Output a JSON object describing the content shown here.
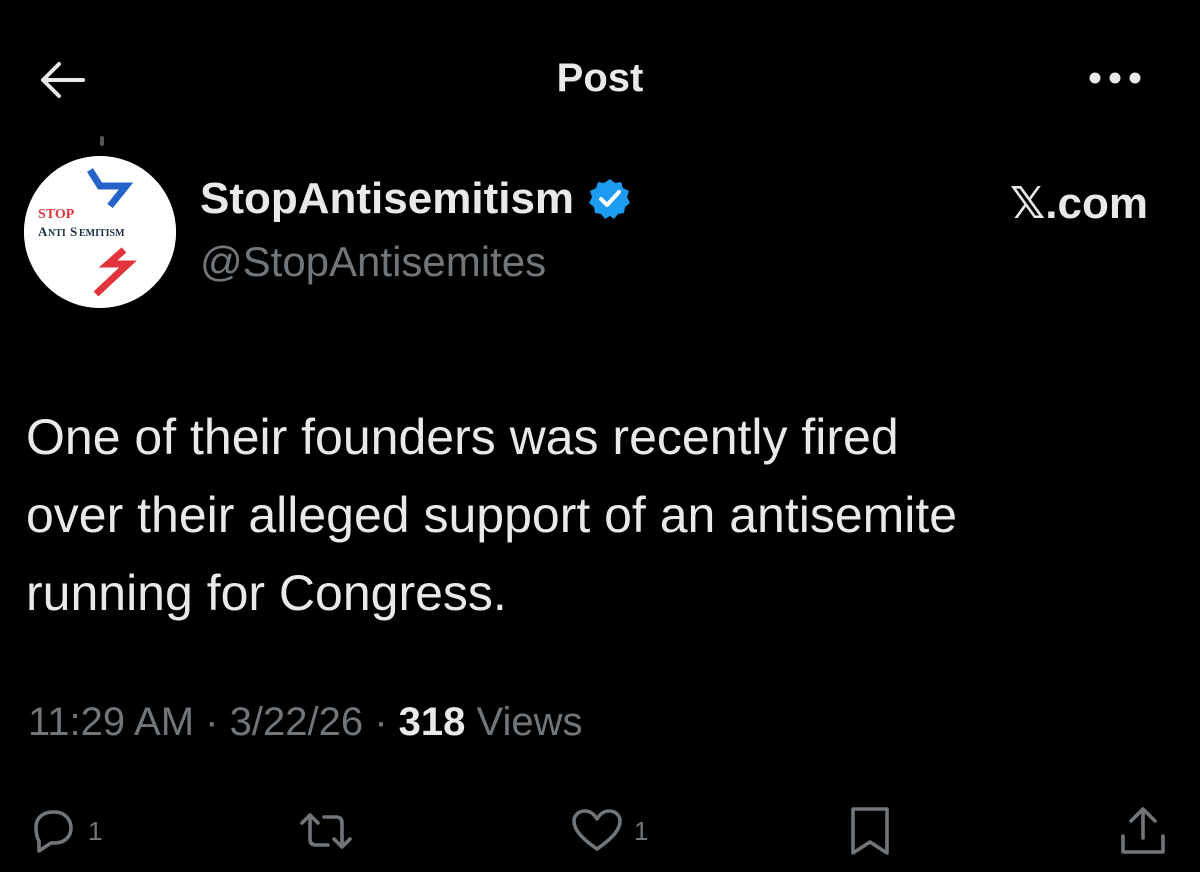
{
  "header": {
    "title": "Post",
    "back_icon": "arrow-left-icon",
    "more_icon": "more-horizontal-icon"
  },
  "author": {
    "display_name": "StopAntisemitism",
    "handle": "@StopAntisemites",
    "verified": true,
    "verified_color": "#1d9bf0",
    "avatar_logo_text": [
      "STOP",
      "ANTISEMITISM"
    ],
    "avatar_colors": {
      "blue": "#2563c9",
      "red": "#e3343c",
      "background": "#ffffff"
    }
  },
  "source": "𝕏.com",
  "tweet": {
    "lines": [
      "One of their founders was recently fired",
      "over their alleged support of an antisemite",
      "running for Congress."
    ]
  },
  "meta": {
    "time": "11:29 AM",
    "date": "3/22/26",
    "separator": "·",
    "views_count": "318",
    "views_label": "Views"
  },
  "actions": {
    "reply": {
      "icon": "reply-icon",
      "count": "1"
    },
    "repost": {
      "icon": "repost-icon",
      "count": ""
    },
    "like": {
      "icon": "heart-icon",
      "count": "1"
    },
    "bookmark": {
      "icon": "bookmark-icon"
    },
    "share": {
      "icon": "share-icon"
    }
  },
  "colors": {
    "background": "#000000",
    "text_primary": "#e7e9ea",
    "text_secondary": "#71767b"
  }
}
